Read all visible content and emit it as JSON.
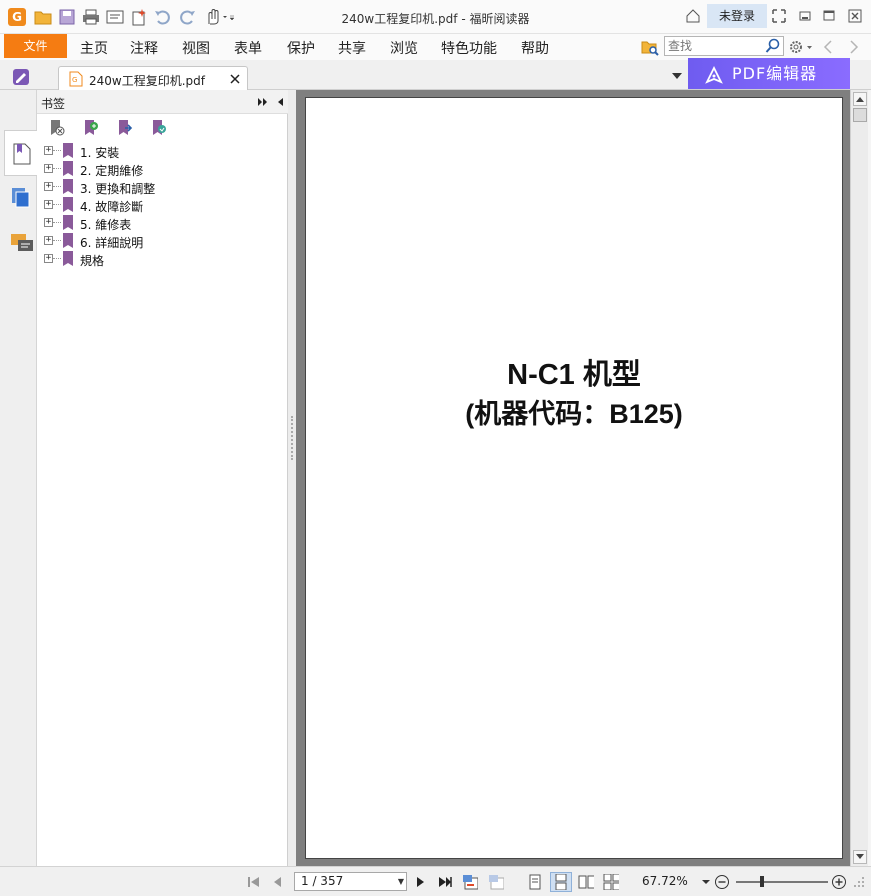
{
  "titlebar": {
    "window_title": "240w工程复印机.pdf - 福昕阅读器",
    "login_label": "未登录"
  },
  "menubar": {
    "file_label": "文件",
    "items": [
      "主页",
      "注释",
      "视图",
      "表单",
      "保护",
      "共享",
      "浏览",
      "特色功能",
      "帮助"
    ],
    "search_placeholder": "查找"
  },
  "tabs": {
    "doc_tab_label": "240w工程复印机.pdf",
    "editor_button_label": "PDF编辑器"
  },
  "bookmarks": {
    "panel_title": "书签",
    "items": [
      "1. 安裝",
      "2. 定期維修",
      "3. 更換和調整",
      "4. 故障診斷",
      "5. 維修表",
      "6. 詳細說明",
      "規格"
    ]
  },
  "document": {
    "title_line1": "N-C1 机型",
    "title_line2": "(机器代码：B125)"
  },
  "statusbar": {
    "page_indicator": "1 / 357",
    "zoom_level": "67.72%"
  },
  "colors": {
    "accent_orange": "#f57c12",
    "bookmark_purple": "#8a5a9a",
    "editor_purple": "#7a62f5"
  }
}
